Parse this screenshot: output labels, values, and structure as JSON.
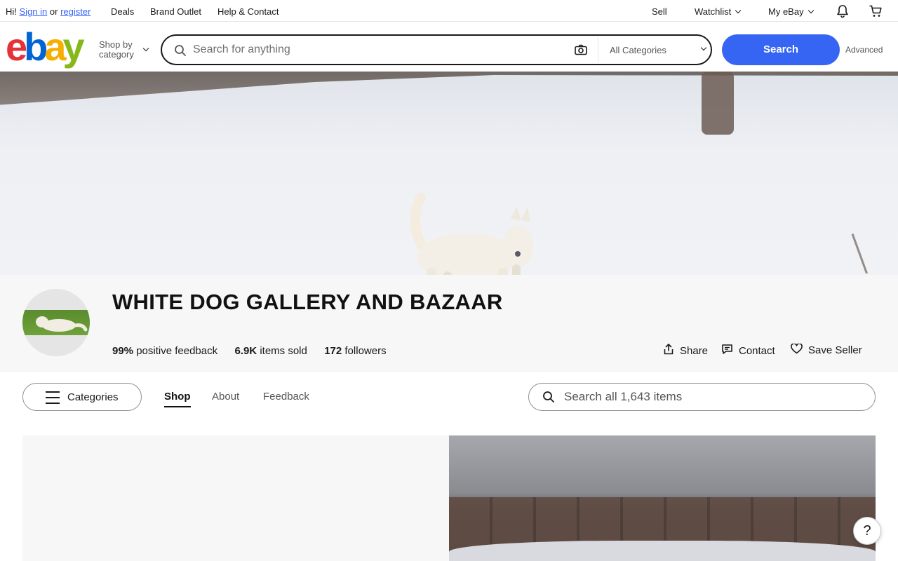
{
  "topbar": {
    "greeting": "Hi!",
    "sign_in": "Sign in",
    "or": "or",
    "register": "register",
    "deals": "Deals",
    "brand_outlet": "Brand Outlet",
    "help_contact": "Help & Contact",
    "sell": "Sell",
    "watchlist": "Watchlist",
    "my_ebay": "My eBay"
  },
  "header": {
    "logo": {
      "e": "e",
      "b": "b",
      "a": "a",
      "y": "y"
    },
    "shop_by_line1": "Shop by",
    "shop_by_line2": "category",
    "search_placeholder": "Search for anything",
    "category_select": "All Categories",
    "search_button": "Search",
    "advanced": "Advanced"
  },
  "store": {
    "title": "WHITE DOG GALLERY AND BAZAAR",
    "feedback_pct": "99%",
    "feedback_label": "positive feedback",
    "items_sold_num": "6.9K",
    "items_sold_label": "items sold",
    "followers_num": "172",
    "followers_label": "followers",
    "share": "Share",
    "contact": "Contact",
    "save_seller": "Save Seller"
  },
  "nav": {
    "categories": "Categories",
    "tabs": [
      "Shop",
      "About",
      "Feedback"
    ],
    "active_tab": "Shop",
    "store_search_placeholder": "Search all 1,643 items"
  },
  "help": {
    "label": "?"
  },
  "colors": {
    "accent": "#3665f3",
    "logo_e": "#e53238",
    "logo_b": "#0064d2",
    "logo_a": "#f5af02",
    "logo_y": "#86b817"
  },
  "icons": [
    "bell-icon",
    "cart-icon",
    "search-icon",
    "camera-icon",
    "share-icon",
    "contact-icon",
    "heart-icon",
    "hamburger-icon",
    "help-icon"
  ]
}
